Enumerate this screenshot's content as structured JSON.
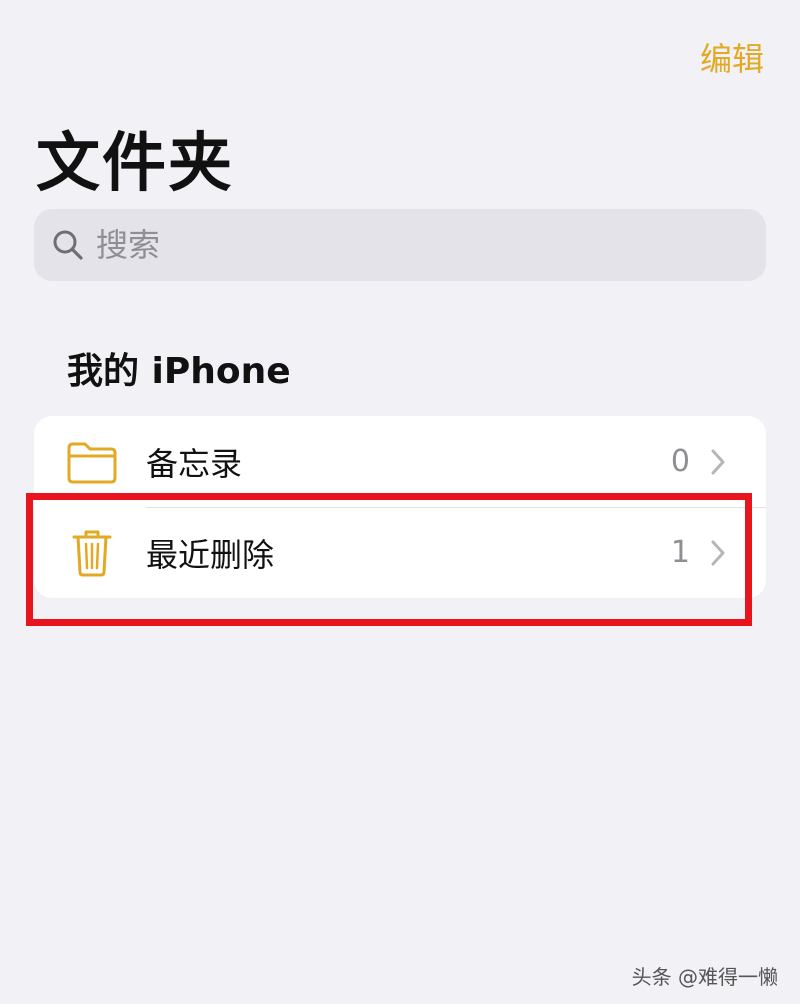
{
  "header": {
    "edit_label": "编辑",
    "title": "文件夹"
  },
  "search": {
    "placeholder": "搜索"
  },
  "section": {
    "title": "我的 iPhone"
  },
  "folders": [
    {
      "label": "备忘录",
      "count": "0",
      "icon": "folder-icon"
    },
    {
      "label": "最近删除",
      "count": "1",
      "icon": "trash-icon"
    }
  ],
  "colors": {
    "accent": "#E2A923",
    "highlight": "#E8141E",
    "background": "#F1F1F6"
  },
  "watermark": "头条 @难得一懒"
}
